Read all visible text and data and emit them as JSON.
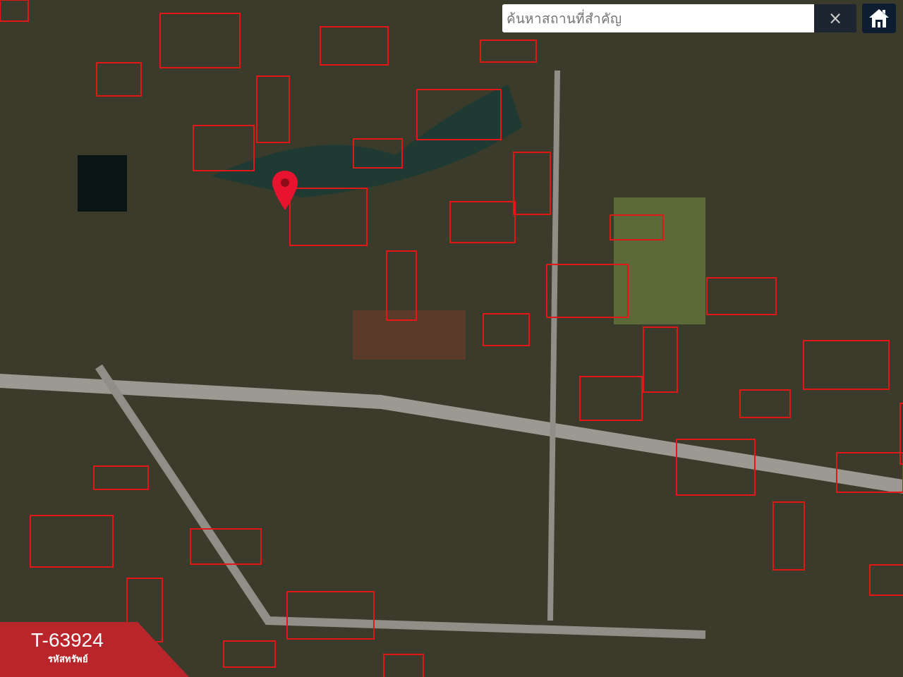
{
  "search": {
    "placeholder": "ค้นหาสถานที่สำคัญ",
    "clear_label": "×"
  },
  "property": {
    "code": "T-63924",
    "caption": "รหัสทรัพย์"
  }
}
